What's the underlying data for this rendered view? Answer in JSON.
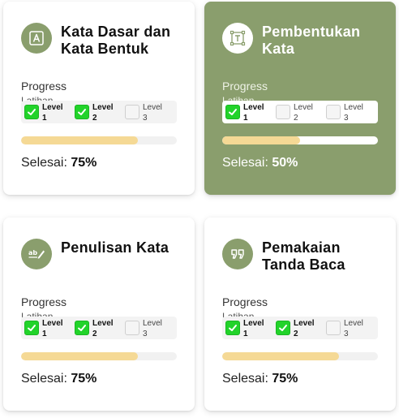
{
  "cards": [
    {
      "title": "Kata Dasar dan Kata Bentuk",
      "icon": "letter-a-box-icon",
      "active": false,
      "progress_label": "Progress",
      "latihan_label": "Latihan",
      "levels": [
        {
          "label": "Level",
          "num": "1",
          "done": true
        },
        {
          "label": "Level",
          "num": "2",
          "done": true
        },
        {
          "label": "Level",
          "num": "3",
          "done": false
        }
      ],
      "progress": 0.75,
      "status_label": "Selesai:",
      "status_value": "75%"
    },
    {
      "title": "Pembentukan Kata",
      "icon": "text-frame-icon",
      "active": true,
      "progress_label": "Progress",
      "latihan_label": "Latihan",
      "levels": [
        {
          "label": "Level",
          "num": "1",
          "done": true
        },
        {
          "label": "Level",
          "num": "2",
          "done": false
        },
        {
          "label": "Level",
          "num": "3",
          "done": false
        }
      ],
      "progress": 0.5,
      "status_label": "Selesai:",
      "status_value": "50%"
    },
    {
      "title": "Penulisan Kata",
      "icon": "spell-check-pen-icon",
      "active": false,
      "progress_label": "Progress",
      "latihan_label": "Latihan",
      "levels": [
        {
          "label": "Level",
          "num": "1",
          "done": true
        },
        {
          "label": "Level",
          "num": "2",
          "done": true
        },
        {
          "label": "Level",
          "num": "3",
          "done": false
        }
      ],
      "progress": 0.75,
      "status_label": "Selesai:",
      "status_value": "75%"
    },
    {
      "title": "Pemakaian Tanda Baca",
      "icon": "quote-mark-icon",
      "active": false,
      "progress_label": "Progress",
      "latihan_label": "Latihan",
      "levels": [
        {
          "label": "Level",
          "num": "1",
          "done": true
        },
        {
          "label": "Level",
          "num": "2",
          "done": true
        },
        {
          "label": "Level",
          "num": "3",
          "done": false
        }
      ],
      "progress": 0.75,
      "status_label": "Selesai:",
      "status_value": "75%"
    }
  ],
  "colors": {
    "accent": "#8a9e6d",
    "check": "#22d32a",
    "progress_fill": "#f5d995"
  }
}
